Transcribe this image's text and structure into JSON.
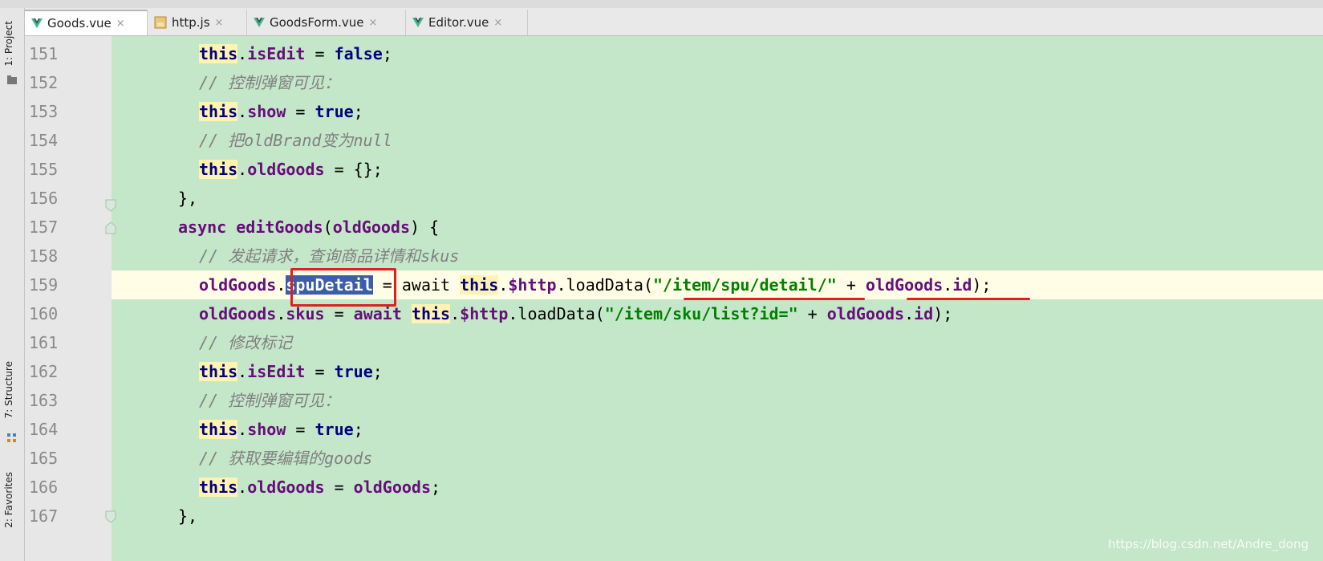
{
  "tabs": [
    {
      "label": "Goods.vue",
      "icon": "vue-icon",
      "active": true
    },
    {
      "label": "http.js",
      "icon": "js-file-icon",
      "active": false
    },
    {
      "label": "GoodsForm.vue",
      "icon": "vue-icon",
      "active": false
    },
    {
      "label": "Editor.vue",
      "icon": "vue-icon",
      "active": false
    }
  ],
  "close_glyph": "×",
  "sidebar": {
    "project": "1: Project",
    "structure": "7: Structure",
    "favorites": "2: Favorites"
  },
  "lines": [
    {
      "num": "151",
      "tokens": [
        {
          "t": "this",
          "c": "kw this"
        },
        {
          "t": ".",
          "c": "plain"
        },
        {
          "t": "isEdit",
          "c": "purple"
        },
        {
          "t": " = ",
          "c": "plain"
        },
        {
          "t": "false",
          "c": "kw"
        },
        {
          "t": ";",
          "c": "plain"
        }
      ]
    },
    {
      "num": "152",
      "tokens": [
        {
          "t": "// 控制弹窗可见：",
          "c": "cmt"
        }
      ]
    },
    {
      "num": "153",
      "tokens": [
        {
          "t": "this",
          "c": "kw this"
        },
        {
          "t": ".",
          "c": "plain"
        },
        {
          "t": "show",
          "c": "purple"
        },
        {
          "t": " = ",
          "c": "plain"
        },
        {
          "t": "true",
          "c": "kw"
        },
        {
          "t": ";",
          "c": "plain"
        }
      ]
    },
    {
      "num": "154",
      "tokens": [
        {
          "t": "// 把oldBrand变为null",
          "c": "cmt"
        }
      ]
    },
    {
      "num": "155",
      "tokens": [
        {
          "t": "this",
          "c": "kw this"
        },
        {
          "t": ".",
          "c": "plain"
        },
        {
          "t": "oldGoods",
          "c": "purple"
        },
        {
          "t": " = {};",
          "c": "plain"
        }
      ]
    },
    {
      "num": "156",
      "tokens": [
        {
          "t": "},",
          "c": "plain"
        }
      ]
    },
    {
      "num": "157",
      "tokens": [
        {
          "t": "async",
          "c": "purple"
        },
        {
          "t": " ",
          "c": "plain"
        },
        {
          "t": "editGoods",
          "c": "purple"
        },
        {
          "t": "(",
          "c": "plain"
        },
        {
          "t": "oldGoods",
          "c": "purple"
        },
        {
          "t": ") {",
          "c": "plain"
        }
      ]
    },
    {
      "num": "158",
      "tokens": [
        {
          "t": "// 发起请求，查询商品详情和skus",
          "c": "cmt"
        }
      ]
    },
    {
      "num": "159",
      "tokens": [
        {
          "t": "oldGoods",
          "c": "purple"
        },
        {
          "t": ".",
          "c": "plain"
        },
        {
          "t": "spuDetail",
          "c": "hl"
        },
        {
          "t": " = ",
          "c": "plain"
        },
        {
          "t": "await",
          "c": "plain"
        },
        {
          "t": " ",
          "c": "plain"
        },
        {
          "t": "this",
          "c": "kw this"
        },
        {
          "t": ".",
          "c": "plain"
        },
        {
          "t": "$http",
          "c": "purple"
        },
        {
          "t": ".",
          "c": "plain"
        },
        {
          "t": "loadData",
          "c": "plain"
        },
        {
          "t": "(",
          "c": "plain"
        },
        {
          "t": "\"/item/spu/detail/\"",
          "c": "str"
        },
        {
          "t": " + ",
          "c": "plain"
        },
        {
          "t": "oldGoods",
          "c": "purple"
        },
        {
          "t": ".",
          "c": "plain"
        },
        {
          "t": "id",
          "c": "purple"
        },
        {
          "t": ");",
          "c": "plain"
        }
      ]
    },
    {
      "num": "160",
      "tokens": [
        {
          "t": "oldGoods",
          "c": "purple"
        },
        {
          "t": ".",
          "c": "plain"
        },
        {
          "t": "skus",
          "c": "purple"
        },
        {
          "t": " = ",
          "c": "plain"
        },
        {
          "t": "await",
          "c": "purple"
        },
        {
          "t": " ",
          "c": "plain"
        },
        {
          "t": "this",
          "c": "kw this"
        },
        {
          "t": ".",
          "c": "plain"
        },
        {
          "t": "$http",
          "c": "purple"
        },
        {
          "t": ".",
          "c": "plain"
        },
        {
          "t": "loadData",
          "c": "plain"
        },
        {
          "t": "(",
          "c": "plain"
        },
        {
          "t": "\"/item/sku/list?id=\"",
          "c": "str"
        },
        {
          "t": " + ",
          "c": "plain"
        },
        {
          "t": "oldGoods",
          "c": "purple"
        },
        {
          "t": ".",
          "c": "plain"
        },
        {
          "t": "id",
          "c": "purple"
        },
        {
          "t": ");",
          "c": "plain"
        }
      ]
    },
    {
      "num": "161",
      "tokens": [
        {
          "t": "// 修改标记",
          "c": "cmt"
        }
      ]
    },
    {
      "num": "162",
      "tokens": [
        {
          "t": "this",
          "c": "kw this"
        },
        {
          "t": ".",
          "c": "plain"
        },
        {
          "t": "isEdit",
          "c": "purple"
        },
        {
          "t": " = ",
          "c": "plain"
        },
        {
          "t": "true",
          "c": "kw"
        },
        {
          "t": ";",
          "c": "plain"
        }
      ]
    },
    {
      "num": "163",
      "tokens": [
        {
          "t": "// 控制弹窗可见：",
          "c": "cmt"
        }
      ]
    },
    {
      "num": "164",
      "tokens": [
        {
          "t": "this",
          "c": "kw this"
        },
        {
          "t": ".",
          "c": "plain"
        },
        {
          "t": "show",
          "c": "purple"
        },
        {
          "t": " = ",
          "c": "plain"
        },
        {
          "t": "true",
          "c": "kw"
        },
        {
          "t": ";",
          "c": "plain"
        }
      ]
    },
    {
      "num": "165",
      "tokens": [
        {
          "t": "// 获取要编辑的goods",
          "c": "cmt"
        }
      ]
    },
    {
      "num": "166",
      "tokens": [
        {
          "t": "this",
          "c": "kw this"
        },
        {
          "t": ".",
          "c": "plain"
        },
        {
          "t": "oldGoods",
          "c": "purple"
        },
        {
          "t": " = ",
          "c": "plain"
        },
        {
          "t": "oldGoods",
          "c": "purple"
        },
        {
          "t": ";",
          "c": "plain"
        }
      ]
    },
    {
      "num": "167",
      "tokens": [
        {
          "t": "},",
          "c": "plain"
        }
      ]
    }
  ],
  "current_line": "159",
  "watermark": "https://blog.csdn.net/Andre_dong"
}
